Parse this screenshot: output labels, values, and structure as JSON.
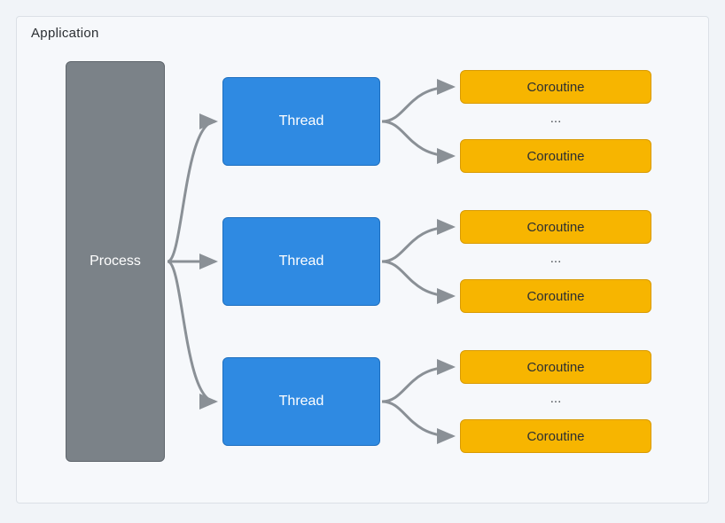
{
  "frame": {
    "title": "Application"
  },
  "process": {
    "label": "Process"
  },
  "threads": [
    {
      "label": "Thread"
    },
    {
      "label": "Thread"
    },
    {
      "label": "Thread"
    }
  ],
  "coroutine_groups": [
    {
      "top_label": "Coroutine",
      "ellipsis": "...",
      "bottom_label": "Coroutine"
    },
    {
      "top_label": "Coroutine",
      "ellipsis": "...",
      "bottom_label": "Coroutine"
    },
    {
      "top_label": "Coroutine",
      "ellipsis": "...",
      "bottom_label": "Coroutine"
    }
  ],
  "colors": {
    "process_bg": "#7b8288",
    "thread_bg": "#2f8ae2",
    "coroutine_bg": "#f7b500",
    "frame_border": "#dbe0e6",
    "connector": "#8a9096"
  }
}
